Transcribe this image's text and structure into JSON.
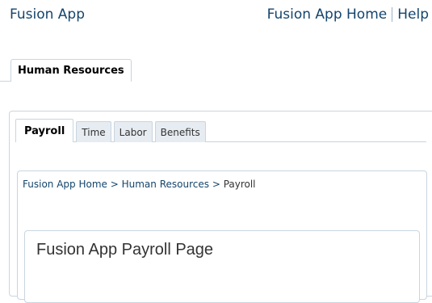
{
  "header": {
    "app_title": "Fusion App",
    "links": [
      "Fusion App Home",
      "Help"
    ]
  },
  "level1_tabs": [
    {
      "label": "Human Resources",
      "active": true
    }
  ],
  "sub_tabs": [
    {
      "label": "Payroll",
      "active": true
    },
    {
      "label": "Time",
      "active": false
    },
    {
      "label": "Labor",
      "active": false
    },
    {
      "label": "Benefits",
      "active": false
    }
  ],
  "breadcrumb": {
    "items": [
      "Fusion App Home",
      "Human Resources"
    ],
    "separator": ">",
    "current": "Payroll"
  },
  "page": {
    "heading": "Fusion App Payroll Page"
  }
}
